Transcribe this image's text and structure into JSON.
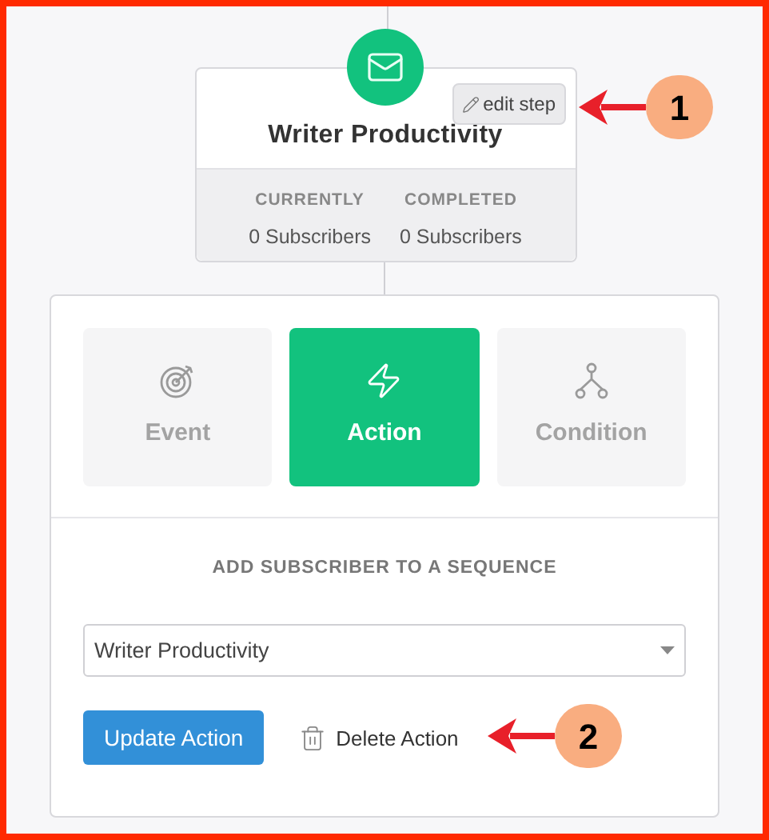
{
  "step": {
    "title": "Writer Productivity",
    "edit_label": "edit step",
    "stats": [
      {
        "label": "CURRENTLY",
        "value": "0 Subscribers"
      },
      {
        "label": "COMPLETED",
        "value": "0 Subscribers"
      }
    ]
  },
  "tabs": [
    {
      "label": "Event",
      "kind": "event",
      "selected": false
    },
    {
      "label": "Action",
      "kind": "action",
      "selected": true
    },
    {
      "label": "Condition",
      "kind": "condition",
      "selected": false
    }
  ],
  "section_title": "ADD SUBSCRIBER TO A SEQUENCE",
  "sequence_select": {
    "value": "Writer Productivity"
  },
  "buttons": {
    "update": "Update Action",
    "delete": "Delete Action"
  },
  "annotations": [
    {
      "number": "1"
    },
    {
      "number": "2"
    }
  ]
}
